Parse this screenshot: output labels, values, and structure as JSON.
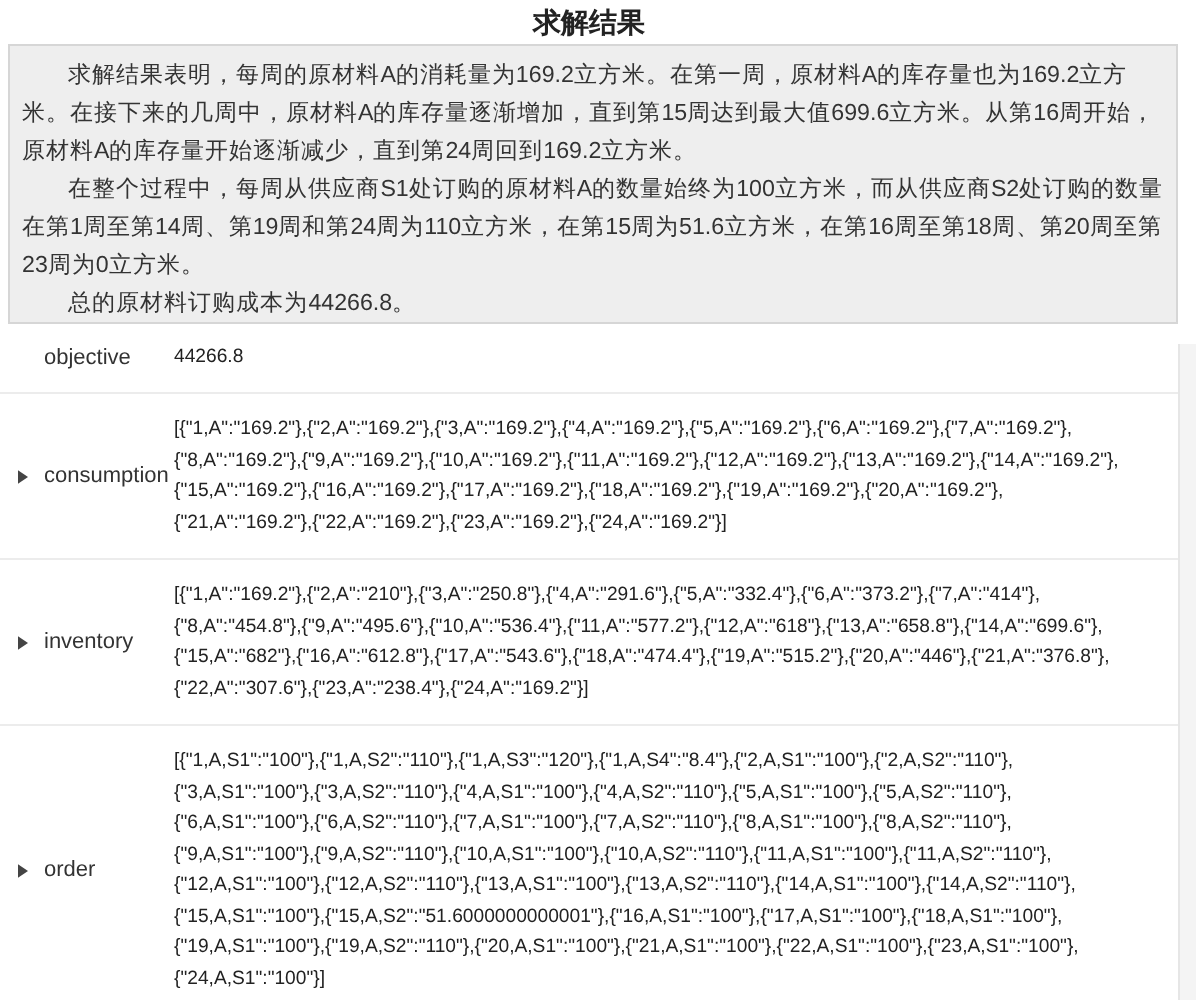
{
  "title": "求解结果",
  "summary": [
    "求解结果表明，每周的原材料A的消耗量为169.2立方米。在第一周，原材料A的库存量也为169.2立方米。在接下来的几周中，原材料A的库存量逐渐增加，直到第15周达到最大值699.6立方米。从第16周开始，原材料A的库存量开始逐渐减少，直到第24周回到169.2立方米。",
    "在整个过程中，每周从供应商S1处订购的原材料A的数量始终为100立方米，而从供应商S2处订购的数量在第1周至第14周、第19周和第24周为110立方米，在第15周为51.6立方米，在第16周至第18周、第20周至第23周为0立方米。",
    "总的原材料订购成本为44266.8。"
  ],
  "rows": [
    {
      "kind": "scalar",
      "label": "objective",
      "value": [
        "44266.8"
      ]
    },
    {
      "kind": "list",
      "expanded": false,
      "label": "consumption",
      "value": [
        "[{\"1,A\":\"169.2\"},{\"2,A\":\"169.2\"},{\"3,A\":\"169.2\"},{\"4,A\":\"169.2\"},{\"5,A\":\"169.2\"},{\"6,A\":\"169.2\"},{\"7,A\":\"169.2\"},",
        "{\"8,A\":\"169.2\"},{\"9,A\":\"169.2\"},{\"10,A\":\"169.2\"},{\"11,A\":\"169.2\"},{\"12,A\":\"169.2\"},{\"13,A\":\"169.2\"},{\"14,A\":\"169.2\"},",
        "{\"15,A\":\"169.2\"},{\"16,A\":\"169.2\"},{\"17,A\":\"169.2\"},{\"18,A\":\"169.2\"},{\"19,A\":\"169.2\"},{\"20,A\":\"169.2\"},",
        "{\"21,A\":\"169.2\"},{\"22,A\":\"169.2\"},{\"23,A\":\"169.2\"},{\"24,A\":\"169.2\"}]"
      ]
    },
    {
      "kind": "list",
      "expanded": false,
      "label": "inventory",
      "value": [
        "[{\"1,A\":\"169.2\"},{\"2,A\":\"210\"},{\"3,A\":\"250.8\"},{\"4,A\":\"291.6\"},{\"5,A\":\"332.4\"},{\"6,A\":\"373.2\"},{\"7,A\":\"414\"},",
        "{\"8,A\":\"454.8\"},{\"9,A\":\"495.6\"},{\"10,A\":\"536.4\"},{\"11,A\":\"577.2\"},{\"12,A\":\"618\"},{\"13,A\":\"658.8\"},{\"14,A\":\"699.6\"},",
        "{\"15,A\":\"682\"},{\"16,A\":\"612.8\"},{\"17,A\":\"543.6\"},{\"18,A\":\"474.4\"},{\"19,A\":\"515.2\"},{\"20,A\":\"446\"},{\"21,A\":\"376.8\"},",
        "{\"22,A\":\"307.6\"},{\"23,A\":\"238.4\"},{\"24,A\":\"169.2\"}]"
      ]
    },
    {
      "kind": "list",
      "expanded": false,
      "label": "order",
      "value": [
        "[{\"1,A,S1\":\"100\"},{\"1,A,S2\":\"110\"},{\"1,A,S3\":\"120\"},{\"1,A,S4\":\"8.4\"},{\"2,A,S1\":\"100\"},{\"2,A,S2\":\"110\"},",
        "{\"3,A,S1\":\"100\"},{\"3,A,S2\":\"110\"},{\"4,A,S1\":\"100\"},{\"4,A,S2\":\"110\"},{\"5,A,S1\":\"100\"},{\"5,A,S2\":\"110\"},",
        "{\"6,A,S1\":\"100\"},{\"6,A,S2\":\"110\"},{\"7,A,S1\":\"100\"},{\"7,A,S2\":\"110\"},{\"8,A,S1\":\"100\"},{\"8,A,S2\":\"110\"},",
        "{\"9,A,S1\":\"100\"},{\"9,A,S2\":\"110\"},{\"10,A,S1\":\"100\"},{\"10,A,S2\":\"110\"},{\"11,A,S1\":\"100\"},{\"11,A,S2\":\"110\"},",
        "{\"12,A,S1\":\"100\"},{\"12,A,S2\":\"110\"},{\"13,A,S1\":\"100\"},{\"13,A,S2\":\"110\"},{\"14,A,S1\":\"100\"},{\"14,A,S2\":\"110\"},",
        "{\"15,A,S1\":\"100\"},{\"15,A,S2\":\"51.6000000000001\"},{\"16,A,S1\":\"100\"},{\"17,A,S1\":\"100\"},{\"18,A,S1\":\"100\"},",
        "{\"19,A,S1\":\"100\"},{\"19,A,S2\":\"110\"},{\"20,A,S1\":\"100\"},{\"21,A,S1\":\"100\"},{\"22,A,S1\":\"100\"},{\"23,A,S1\":\"100\"},",
        "{\"24,A,S1\":\"100\"}]"
      ]
    }
  ]
}
